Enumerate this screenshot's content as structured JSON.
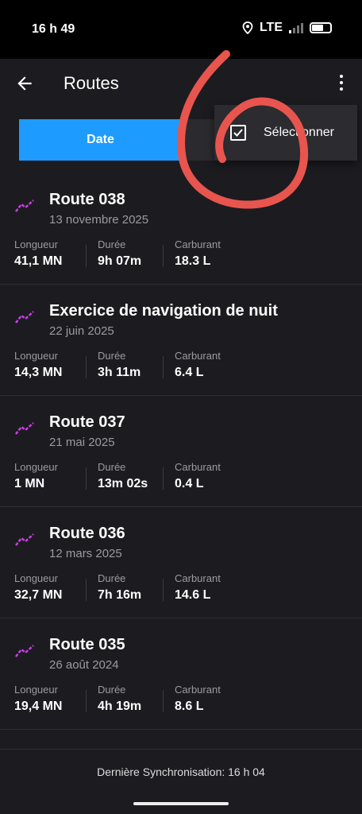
{
  "status_bar": {
    "time": "16 h 49",
    "network": "LTE"
  },
  "app_bar": {
    "title": "Routes"
  },
  "tabs": [
    {
      "label": "Date",
      "active": true
    },
    {
      "label": "",
      "active": false
    }
  ],
  "menu": {
    "items": [
      {
        "label": "Sélectionner",
        "icon": "checkbox-icon"
      }
    ]
  },
  "routes": [
    {
      "title": "Route 038",
      "date": "13 novembre 2025",
      "length_label": "Longueur",
      "length": "41,1 MN",
      "duration_label": "Durée",
      "duration": "9h 07m",
      "fuel_label": "Carburant",
      "fuel": "18.3 L"
    },
    {
      "title": "Exercice de navigation de nuit",
      "date": "22 juin 2025",
      "length_label": "Longueur",
      "length": "14,3 MN",
      "duration_label": "Durée",
      "duration": "3h 11m",
      "fuel_label": "Carburant",
      "fuel": "6.4 L"
    },
    {
      "title": "Route 037",
      "date": "21 mai 2025",
      "length_label": "Longueur",
      "length": "1 MN",
      "duration_label": "Durée",
      "duration": "13m 02s",
      "fuel_label": "Carburant",
      "fuel": "0.4 L"
    },
    {
      "title": "Route 036",
      "date": "12 mars 2025",
      "length_label": "Longueur",
      "length": "32,7 MN",
      "duration_label": "Durée",
      "duration": "7h 16m",
      "fuel_label": "Carburant",
      "fuel": "14.6 L"
    },
    {
      "title": "Route 035",
      "date": "26 août 2024",
      "length_label": "Longueur",
      "length": "19,4 MN",
      "duration_label": "Durée",
      "duration": "4h 19m",
      "fuel_label": "Carburant",
      "fuel": "8.6 L"
    }
  ],
  "footer": {
    "sync": "Dernière Synchronisation: 16 h 04"
  },
  "colors": {
    "accent": "#1e9bff",
    "route_icon": "#d23cf0",
    "annotation": "#e8554e",
    "background": "#1c1c20"
  }
}
